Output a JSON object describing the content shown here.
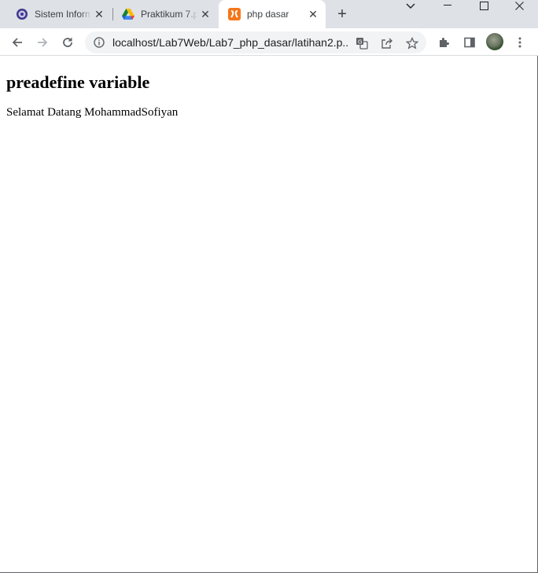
{
  "browser": {
    "tabs": [
      {
        "title": "Sistem Inform",
        "favicon": "university-seal-icon",
        "active": false
      },
      {
        "title": "Praktikum 7.p",
        "favicon": "google-drive-icon",
        "active": false
      },
      {
        "title": "php dasar",
        "favicon": "xampp-icon",
        "active": true
      }
    ],
    "new_tab_label": "+",
    "address_bar": {
      "url": "localhost/Lab7Web/Lab7_php_dasar/latihan2.p..."
    }
  },
  "page": {
    "heading": "preadefine variable",
    "text": "Selamat Datang MohammadSofiyan"
  },
  "colors": {
    "tabstrip_bg": "#dee1e6",
    "active_tab_bg": "#ffffff",
    "omnibox_bg": "#f1f3f4",
    "xampp_orange": "#f5761a"
  }
}
